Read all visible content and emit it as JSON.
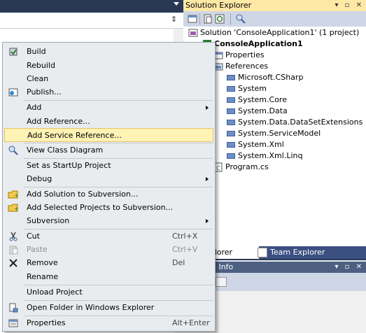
{
  "solution_explorer": {
    "title": "Solution Explorer",
    "title_buttons": "▾ ▫ ✕",
    "tree": {
      "solution": "Solution 'ConsoleApplication1' (1 project)",
      "project": "ConsoleApplication1",
      "properties": "Properties",
      "references": "References",
      "refs": [
        "Microsoft.CSharp",
        "System",
        "System.Core",
        "System.Data",
        "System.Data.DataSetExtensions",
        "System.ServiceModel",
        "System.Xml",
        "System.Xml.Linq"
      ],
      "program": "Program.cs"
    },
    "tabs": {
      "solution_explorer": "ion Explorer",
      "team_explorer": "Team Explorer"
    }
  },
  "properties_window": {
    "title": "n Info",
    "title_buttons": "▾ ▫ ✕"
  },
  "editor": {
    "split_icon": "⇕"
  },
  "context_menu": {
    "items": {
      "build": "Build",
      "rebuild": "Rebuild",
      "clean": "Clean",
      "publish": "Publish...",
      "add": "Add",
      "add_reference": "Add Reference...",
      "add_service_reference": "Add Service Reference...",
      "view_class_diagram": "View Class Diagram",
      "set_startup": "Set as StartUp Project",
      "debug": "Debug",
      "add_solution_svn": "Add Solution to Subversion...",
      "add_projects_svn": "Add Selected Projects to Subversion...",
      "subversion": "Subversion",
      "cut": "Cut",
      "paste": "Paste",
      "remove": "Remove",
      "rename": "Rename",
      "unload": "Unload Project",
      "open_folder": "Open Folder in Windows Explorer",
      "properties": "Properties"
    },
    "shortcuts": {
      "cut": "Ctrl+X",
      "paste": "Ctrl+V",
      "remove": "Del",
      "properties": "Alt+Enter"
    },
    "highlighted": "Add Service Reference..."
  },
  "colors": {
    "chrome": "#293955",
    "highlight": "#fff2b5",
    "title_active": "#ffe8a6"
  }
}
